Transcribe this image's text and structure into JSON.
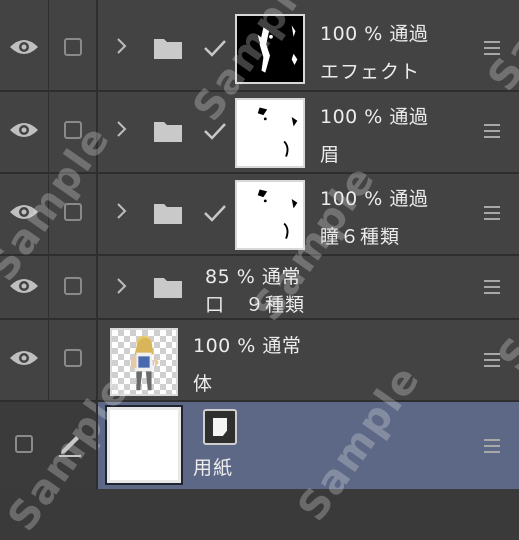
{
  "layers": [
    {
      "opacity": "100 %",
      "blend": "通過",
      "name": "エフェクト",
      "type": "folder"
    },
    {
      "opacity": "100 %",
      "blend": "通過",
      "name": "眉",
      "type": "folder"
    },
    {
      "opacity": "100 %",
      "blend": "通過",
      "name": "瞳６種類",
      "type": "folder"
    },
    {
      "opacity": "85 %",
      "blend": "通常",
      "name": "口　９種類",
      "type": "folder"
    },
    {
      "opacity": "100 %",
      "blend": "通常",
      "name": "体",
      "type": "raster"
    },
    {
      "opacity": "",
      "blend": "",
      "name": "用紙",
      "type": "paper",
      "selected": true
    }
  ],
  "icons": {
    "visibility": "eye-icon",
    "lock": "checkbox",
    "expand": "chevron-right-icon",
    "folder": "folder-icon",
    "clip": "checkmark-icon",
    "edit": "pen-icon",
    "paper": "paper-icon",
    "menu": "hamburger-icon"
  },
  "colors": {
    "panel_bg": "#434343",
    "selected_bg": "#5c6886",
    "separator": "#2e2e2e",
    "text": "#ececec"
  },
  "watermark": "Sample"
}
